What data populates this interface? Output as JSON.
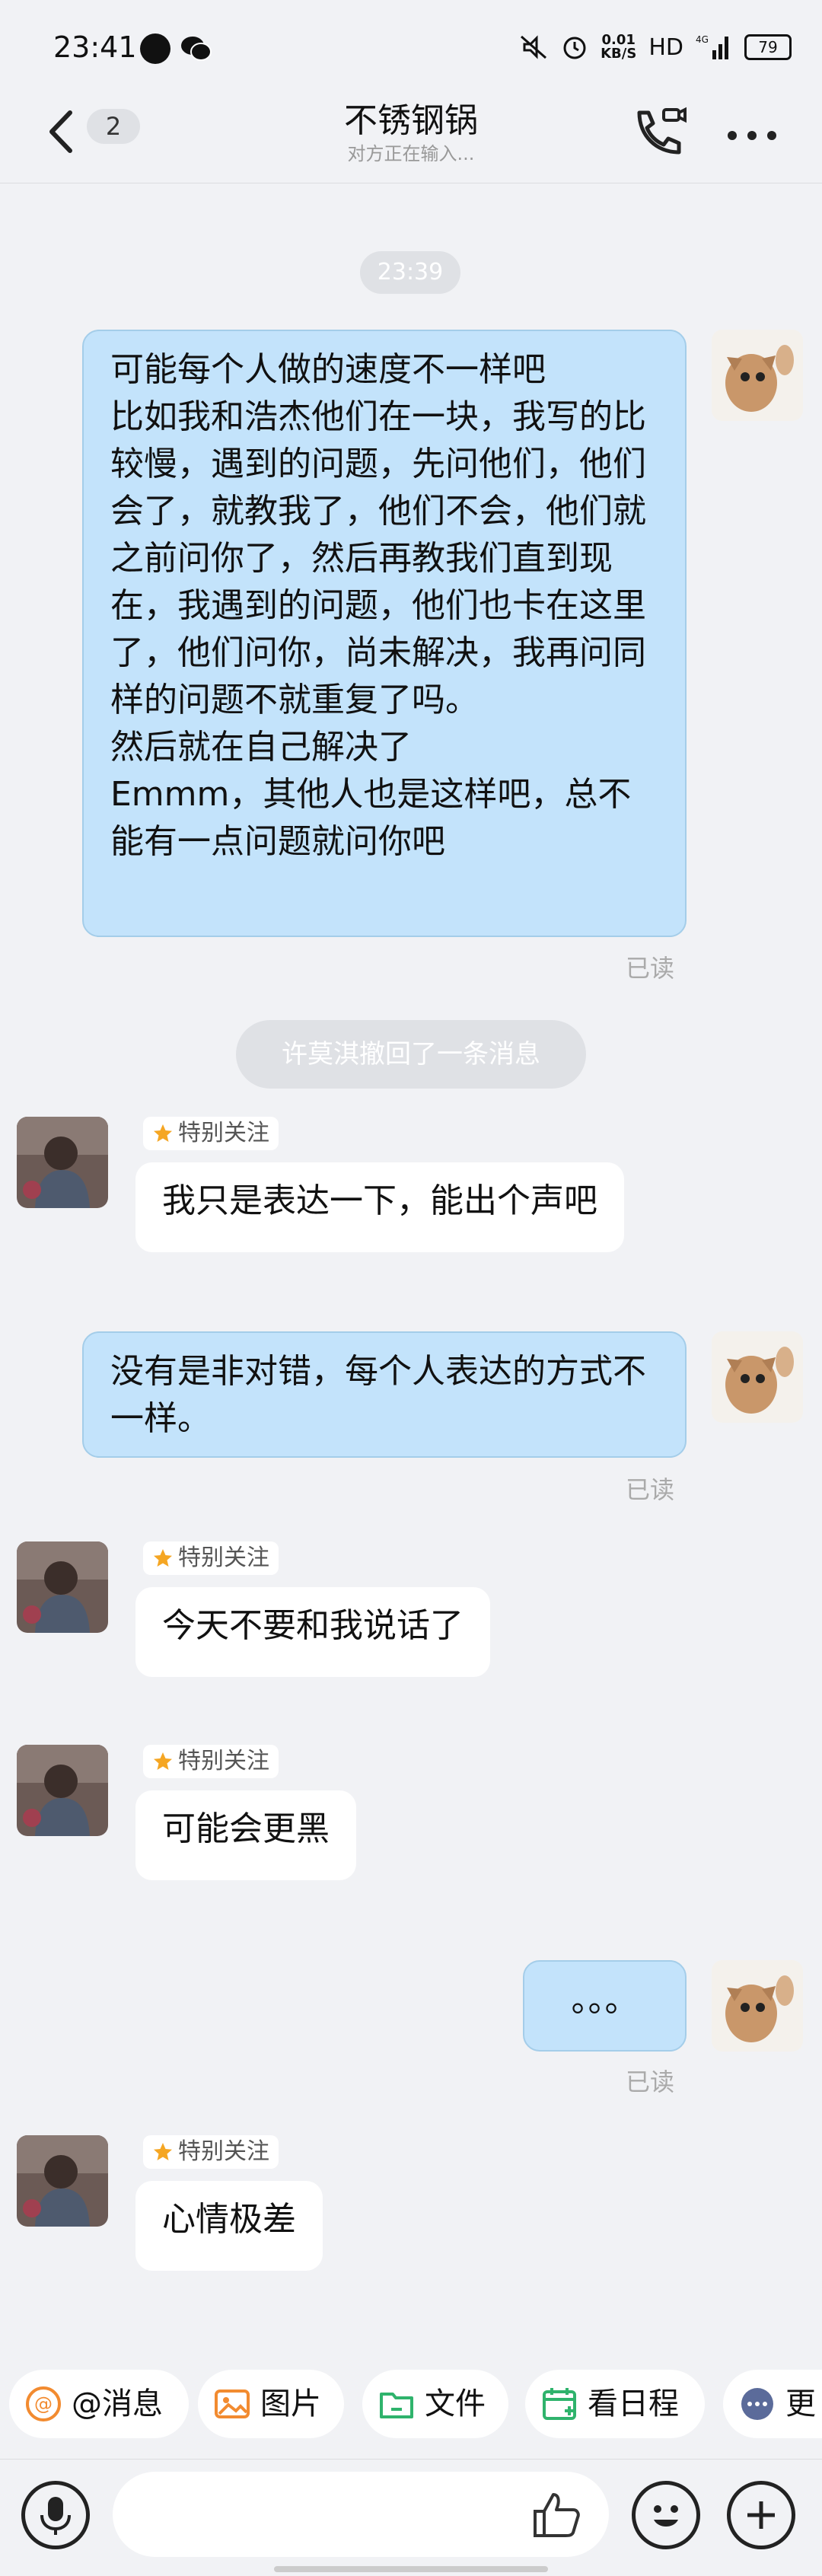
{
  "status_bar": {
    "time": "23:41",
    "speed_value": "0.01",
    "speed_unit": "KB/S",
    "network": "HD",
    "signal": "4G",
    "battery": "79"
  },
  "header": {
    "back_count": "2",
    "title": "不锈钢锅",
    "subtitle": "对方正在输入..."
  },
  "timestamp": "23:39",
  "messages": [
    {
      "side": "mine",
      "text": "可能每个人做的速度不一样吧\n比如我和浩杰他们在一块，我写的比较慢，遇到的问题，先问他们，他们会了，就教我了，他们不会，他们就之前问你了，然后再教我们直到现在，我遇到的问题，他们也卡在这里了，他们问你，尚未解决，我再问同样的问题不就重复了吗。\n然后就在自己解决了\nEmmm，其他人也是这样吧，总不能有一点问题就问你吧",
      "read": "已读"
    },
    {
      "side": "system",
      "text": "许莫淇撤回了一条消息"
    },
    {
      "side": "theirs",
      "tag": "特别关注",
      "text": "我只是表达一下，能出个声吧"
    },
    {
      "side": "mine",
      "text": "没有是非对错，每个人表达的方式不一样。",
      "read": "已读"
    },
    {
      "side": "theirs",
      "tag": "特别关注",
      "text": "今天不要和我说话了"
    },
    {
      "side": "theirs",
      "tag": "特别关注",
      "text": "可能会更黑"
    },
    {
      "side": "mine",
      "text": "。。。",
      "read": "已读"
    },
    {
      "side": "theirs",
      "tag": "特别关注",
      "text": "心情极差"
    }
  ],
  "toolbar": {
    "at": "@消息",
    "image": "图片",
    "file": "文件",
    "calendar": "看日程",
    "more": "更"
  },
  "colors": {
    "mine_bubble": "#c3e3fb",
    "theirs_bubble": "#ffffff",
    "background": "#f1f2f5",
    "tag_star": "#f5a623"
  }
}
